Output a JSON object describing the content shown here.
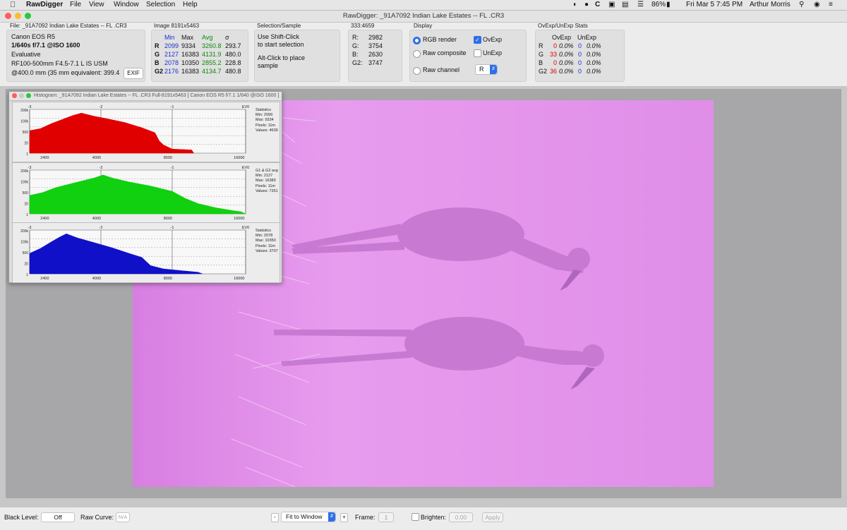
{
  "menubar": {
    "app": "RawDigger",
    "menus": [
      "File",
      "View",
      "Window",
      "Selection",
      "Help"
    ],
    "battery": "86%",
    "clock": "Fri Mar 5  7:45 PM",
    "user": "Arthur Morris"
  },
  "window": {
    "title": "RawDigger: _91A7092 Indian Lake Estates -- FL .CR3"
  },
  "file_panel": {
    "title": "File: _91A7092 Indian Lake Estates -- FL .CR3",
    "camera": "Canon EOS R5",
    "exposure": "1/640s f/7.1 @ISO 1600",
    "metering": "Evaluative",
    "lens": "RF100-500mm F4.5-7.1 L IS USM",
    "focal": "@400.0 mm (35 mm equivalent: 399.4",
    "exif_button": "EXIF"
  },
  "image_panel": {
    "title": "Image 8191x5463",
    "headers": {
      "min": "Min",
      "max": "Max",
      "avg": "Avg",
      "sigma": "σ"
    },
    "rows": [
      {
        "ch": "R",
        "min": "2099",
        "max": "9334",
        "avg": "3260.8",
        "sigma": "293.7"
      },
      {
        "ch": "G",
        "min": "2127",
        "max": "16383",
        "avg": "4131.9",
        "sigma": "480.0"
      },
      {
        "ch": "B",
        "min": "2078",
        "max": "10350",
        "avg": "2855.2",
        "sigma": "228.8"
      },
      {
        "ch": "G2",
        "min": "2176",
        "max": "16383",
        "avg": "4134.7",
        "sigma": "480.8"
      }
    ]
  },
  "selection_panel": {
    "title": "Selection/Sample",
    "line1": "Use Shift-Click",
    "line2": "to start selection",
    "line3": "Alt-Click to place",
    "line4": "sample"
  },
  "sample_panel": {
    "title": "333:4659",
    "rows": [
      {
        "label": "R:",
        "value": "2982"
      },
      {
        "label": "G:",
        "value": "3754"
      },
      {
        "label": "B:",
        "value": "2630"
      },
      {
        "label": "G2:",
        "value": "3747"
      }
    ]
  },
  "display_panel": {
    "title": "Display",
    "rgb_render": "RGB render",
    "raw_composite": "Raw composite",
    "raw_channel": "Raw channel",
    "ovexp": "OvExp",
    "unexp": "UnExp",
    "channel_value": "R"
  },
  "stats_panel": {
    "title": "OvExp/UnExp Stats",
    "headers": {
      "ovexp": "OvExp",
      "unexp": "UnExp"
    },
    "rows": [
      {
        "ch": "R",
        "ov_n": "0",
        "ov_p": "0.0%",
        "un_n": "0",
        "un_p": "0.0%"
      },
      {
        "ch": "G",
        "ov_n": "33",
        "ov_p": "0.0%",
        "un_n": "0",
        "un_p": "0.0%"
      },
      {
        "ch": "B",
        "ov_n": "0",
        "ov_p": "0.0%",
        "un_n": "0",
        "un_p": "0.0%"
      },
      {
        "ch": "G2",
        "ov_n": "36",
        "ov_p": "0.0%",
        "un_n": "0",
        "un_p": "0.0%"
      }
    ]
  },
  "histogram": {
    "title": "Histogram: _91A7092 Indian Lake Estates -- FL .CR3 Full-8191x5463 [ Canon EOS R5 f/7.1 1/640 @ISO 1600 ]",
    "ev_labels": [
      "-3",
      "-2",
      "-1",
      "EV0"
    ],
    "y_ticks": [
      "200k",
      "100k",
      "500",
      "20",
      "1"
    ],
    "x_ticks": [
      "2400",
      "4000",
      "8000",
      "16000"
    ],
    "panels": [
      {
        "color": "#e00000",
        "stats": [
          "Statistics",
          "Min: 2099",
          "Max: 9334",
          "Pixels: 11m",
          "Values: 4639"
        ]
      },
      {
        "color": "#10d010",
        "stats": [
          "G1 & G2 avg",
          "Min: 2127",
          "Max: 16383",
          "Pixels: 11m",
          "Values: 7351"
        ]
      },
      {
        "color": "#1010c8",
        "stats": [
          "Statistics",
          "Min: 2078",
          "Max: 10350",
          "Pixels: 11m",
          "Values: 3707"
        ]
      }
    ]
  },
  "bottombar": {
    "black_level_label": "Black Level:",
    "black_level_value": "Off",
    "raw_curve_label": "Raw Curve:",
    "raw_curve_value": "N/A",
    "minus": "-",
    "zoom": "Fit to Window",
    "plus": "+",
    "frame_label": "Frame:",
    "frame_value": "1",
    "brighten_label": "Brighten:",
    "brighten_value": "0.00",
    "apply": "Apply"
  }
}
